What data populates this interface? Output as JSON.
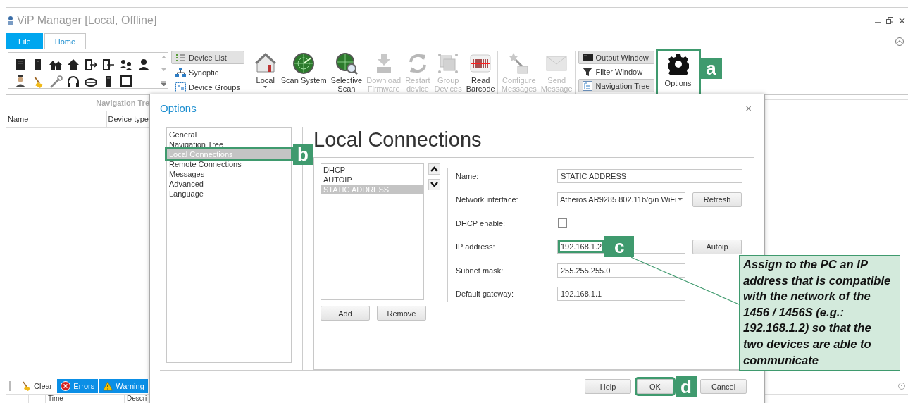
{
  "window": {
    "title": "ViP Manager [Local, Offline]"
  },
  "ribbon_tabs": [
    {
      "label": "File",
      "kind": "file",
      "selected": false
    },
    {
      "label": "Home",
      "kind": "tab",
      "selected": true
    }
  ],
  "views": [
    {
      "label": "Device List",
      "selected": true
    },
    {
      "label": "Synoptic",
      "selected": false
    },
    {
      "label": "Device Groups",
      "selected": false
    }
  ],
  "commands": [
    {
      "label": "Local",
      "disabled": false,
      "dropdown": true
    },
    {
      "label": "Scan System",
      "disabled": false
    },
    {
      "label": "Selective Scan",
      "disabled": false
    },
    {
      "label": "Download Firmware",
      "disabled": true
    },
    {
      "label": "Restart device",
      "disabled": true
    },
    {
      "label": "Group Devices",
      "disabled": true
    },
    {
      "label": "Read Barcode",
      "disabled": false
    },
    {
      "label": "Configure Messages",
      "disabled": true
    },
    {
      "label": "Send Message",
      "disabled": true
    }
  ],
  "panels": [
    {
      "label": "Output Window",
      "selected": true
    },
    {
      "label": "Filter Window",
      "selected": false
    },
    {
      "label": "Navigation Tree",
      "selected": true
    }
  ],
  "options_button": {
    "label": "Options"
  },
  "navigation_tree": {
    "title": "Navigation Tre",
    "columns": [
      "Name",
      "Device type"
    ]
  },
  "output": {
    "buttons": [
      {
        "label": "Clear",
        "selected": false
      },
      {
        "label": "Errors",
        "selected": true
      },
      {
        "label": "Warning",
        "selected": true
      }
    ],
    "columns": [
      "Time",
      "Descri"
    ]
  },
  "dialog": {
    "title": "Options",
    "close": "×",
    "pages": [
      {
        "label": "General",
        "selected": false
      },
      {
        "label": "Navigation Tree",
        "selected": false
      },
      {
        "label": "Local Connections",
        "selected": true
      },
      {
        "label": "Remote Connections",
        "selected": false
      },
      {
        "label": "Messages",
        "selected": false
      },
      {
        "label": "Advanced",
        "selected": false
      },
      {
        "label": "Language",
        "selected": false
      }
    ],
    "heading": "Local Connections",
    "connections": [
      {
        "label": "DHCP",
        "selected": false
      },
      {
        "label": "AUTOIP",
        "selected": false
      },
      {
        "label": "STATIC ADDRESS",
        "selected": true
      }
    ],
    "list_buttons": [
      "Add",
      "Remove"
    ],
    "fields": [
      {
        "kind": "text",
        "label": "Name:",
        "value": "STATIC ADDRESS",
        "wide": true
      },
      {
        "kind": "select",
        "label": "Network interface:",
        "value": "Atheros AR9285 802.11b/g/n WiFi",
        "button": "Refresh"
      },
      {
        "kind": "checkbox",
        "label": "DHCP enable:",
        "checked": false
      },
      {
        "kind": "text",
        "label": "IP address:",
        "value": "192.168.1.2",
        "button": "Autoip"
      },
      {
        "kind": "text",
        "label": "Subnet mask:",
        "value": "255.255.255.0"
      },
      {
        "kind": "text",
        "label": "Default gateway:",
        "value": "192.168.1.1"
      }
    ],
    "buttons": [
      {
        "label": "Help",
        "kind": "help"
      },
      {
        "label": "OK",
        "kind": "ok"
      },
      {
        "label": "Cancel",
        "kind": "cancel"
      }
    ]
  },
  "annotations": {
    "markers": [
      {
        "label": "a"
      },
      {
        "label": "b"
      },
      {
        "label": "c"
      },
      {
        "label": "d"
      }
    ],
    "note": "Assign to the PC an IP address that is compatible with the network of the 1456 / 1456S (e.g.: 192.168.1.2) so that the two devices are able to communicate"
  }
}
